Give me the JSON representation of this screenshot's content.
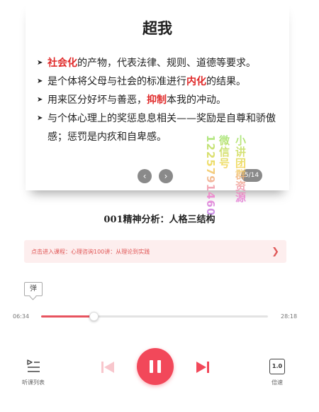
{
  "slide": {
    "title": "超我",
    "bullets": [
      {
        "parts": [
          {
            "text": "社会化",
            "hl": true
          },
          {
            "text": "的产物，代表法律、规则、道德等要求。",
            "hl": false
          }
        ]
      },
      {
        "parts": [
          {
            "text": "是个体将父母与社会的标准进行",
            "hl": false
          },
          {
            "text": "内化",
            "hl": true
          },
          {
            "text": "的结果。",
            "hl": false
          }
        ]
      },
      {
        "parts": [
          {
            "text": "用来区分好坏与善恶，",
            "hl": false
          },
          {
            "text": "抑制",
            "hl": true
          },
          {
            "text": "本我的冲动。",
            "hl": false
          }
        ]
      },
      {
        "parts": [
          {
            "text": "与个体心理上的奖惩息息相关——奖励是自尊和骄傲感；惩罚是内疚和自卑感。",
            "hl": false
          }
        ]
      }
    ],
    "page_indicator": "5/14",
    "prev_icon": "chevron-left-icon",
    "next_icon": "chevron-right-icon"
  },
  "watermark": {
    "lines": [
      "微信号1225791460",
      "小讲团群资源"
    ]
  },
  "lesson_title": "001精神分析：人格三结构",
  "course_link": {
    "text": "点击进入课程：心理咨询100讲：从理论到实践",
    "icon": "chevron-right-icon"
  },
  "danmaku": {
    "label": "弹"
  },
  "player": {
    "current_time": "06:34",
    "total_time": "28:18",
    "progress": 0.232
  },
  "controls": {
    "playlist_label": "听课列表",
    "speed_label": "倍速",
    "speed_value": "1.0"
  },
  "colors": {
    "accent": "#f2485a",
    "highlight": "#e02a2a",
    "link_bg": "#fdeeee"
  }
}
